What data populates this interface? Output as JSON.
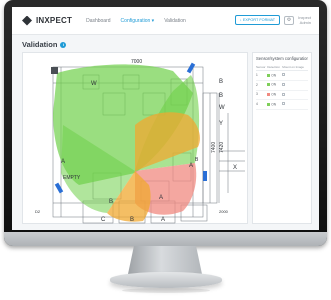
{
  "app": {
    "brand": "INXPECT",
    "nav": [
      {
        "label": "Dashboard",
        "active": false
      },
      {
        "label": "Configuration ▾",
        "active": true
      },
      {
        "label": "Validation",
        "active": false
      }
    ],
    "download_label": "↓ EXPORT FORMAT",
    "gear_icon": "⚙",
    "user_lines": [
      "Inxpect",
      "Admin"
    ]
  },
  "page": {
    "title": "Validation",
    "info_glyph": "i"
  },
  "map": {
    "labels": {
      "top": "7000",
      "w_top": "W",
      "b_top": "B",
      "w_right": "W",
      "b_right": "B",
      "y": "Y",
      "x": "X",
      "a_left": "A",
      "a_right": "A",
      "b_small": "B",
      "b_low": "B",
      "a_low": "A",
      "c": "C",
      "b_bottom": "B",
      "a_bottom": "A",
      "empty": "EMPTY",
      "vertical_1": "7400",
      "vertical_2": "7420",
      "bottom_left": "D2",
      "bottom_mid": "2000"
    }
  },
  "side_panel": {
    "title": "Sensor/system configuration",
    "columns": [
      "Sensor",
      "Detection",
      "Mount on Image"
    ],
    "rows": [
      {
        "sensor": "1",
        "detection": "ON",
        "color": "#7fcf5a"
      },
      {
        "sensor": "2",
        "detection": "ON",
        "color": "#7fcf5a"
      },
      {
        "sensor": "3",
        "detection": "ON",
        "color": "#f08a80"
      },
      {
        "sensor": "4",
        "detection": "ON",
        "color": "#7fcf5a"
      }
    ]
  },
  "colors": {
    "accent": "#1f9bd6",
    "zone_green": "#6fd04a",
    "zone_orange": "#f0a830",
    "zone_red": "#f08a80",
    "sensor": "#2a6fd6"
  }
}
